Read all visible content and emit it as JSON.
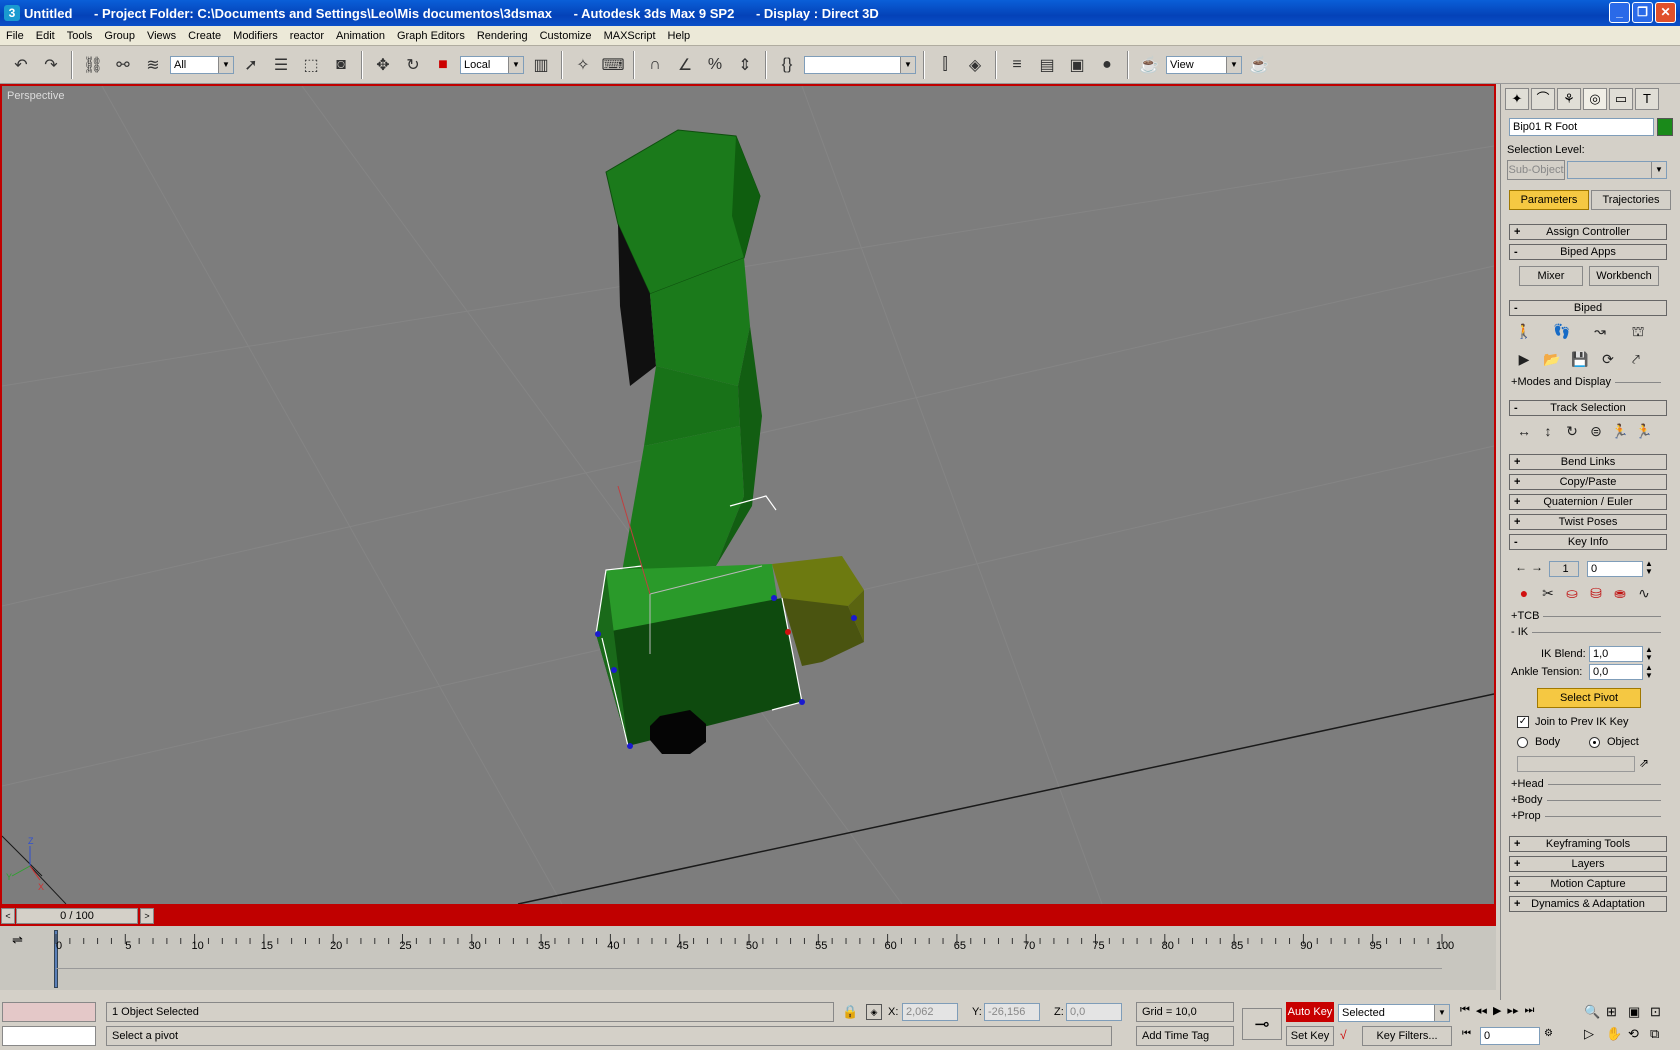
{
  "window": {
    "title": "Untitled      - Project Folder: C:\\Documents and Settings\\Leo\\Mis documentos\\3dsmax      - Autodesk 3ds Max 9 SP2      - Display : Direct 3D"
  },
  "menu": [
    "File",
    "Edit",
    "Tools",
    "Group",
    "Views",
    "Create",
    "Modifiers",
    "reactor",
    "Animation",
    "Graph Editors",
    "Rendering",
    "Customize",
    "MAXScript",
    "Help"
  ],
  "toolbar": {
    "selection_filter": "All",
    "reference_coord": "Local",
    "named_selection": "",
    "render_area": "View"
  },
  "viewport": {
    "label": "Perspective",
    "axis": {
      "x": "X",
      "y": "Y",
      "z": "Z"
    }
  },
  "timeslider": {
    "value": "0 / 100"
  },
  "ruler": {
    "ticks": [
      "0",
      "5",
      "10",
      "15",
      "20",
      "25",
      "30",
      "35",
      "40",
      "45",
      "50",
      "55",
      "60",
      "65",
      "70",
      "75",
      "80",
      "85",
      "90",
      "95",
      "100"
    ]
  },
  "status": {
    "selection": "1 Object Selected",
    "prompt": "Select a pivot",
    "x_label": "X:",
    "x_value": "2,062",
    "y_label": "Y:",
    "y_value": "-26,156",
    "z_label": "Z:",
    "z_value": "0,0",
    "grid": "Grid = 10,0",
    "add_time_tag": "Add Time Tag",
    "auto_key": "Auto Key",
    "set_key": "Set Key",
    "key_mode": "Selected",
    "key_filters": "Key Filters...",
    "frame": "0"
  },
  "command_panel": {
    "object_name": "Bip01 R Foot",
    "selection_level": "Selection Level:",
    "sub_object": "Sub-Object",
    "tab_parameters": "Parameters",
    "tab_trajectories": "Trajectories",
    "rollouts": {
      "assign_controller": "Assign Controller",
      "biped_apps": "Biped Apps",
      "mixer": "Mixer",
      "workbench": "Workbench",
      "biped": "Biped",
      "modes_display": "Modes and Display",
      "track_selection": "Track Selection",
      "bend_links": "Bend Links",
      "copy_paste": "Copy/Paste",
      "quaternion_euler": "Quaternion / Euler",
      "twist_poses": "Twist Poses",
      "key_info": "Key Info",
      "keyframing_tools": "Keyframing Tools",
      "layers": "Layers",
      "motion_capture": "Motion Capture",
      "dynamics": "Dynamics & Adaptation"
    },
    "key_info": {
      "key_number": "1",
      "key_time": "0",
      "tcb": "TCB",
      "ik": "IK",
      "ik_blend_label": "IK Blend:",
      "ik_blend_value": "1,0",
      "ankle_tension_label": "Ankle Tension:",
      "ankle_tension_value": "0,0",
      "select_pivot": "Select Pivot",
      "join_prev": "Join to Prev IK Key",
      "body": "Body",
      "object": "Object",
      "head": "Head",
      "body_sub": "Body",
      "prop": "Prop"
    }
  }
}
